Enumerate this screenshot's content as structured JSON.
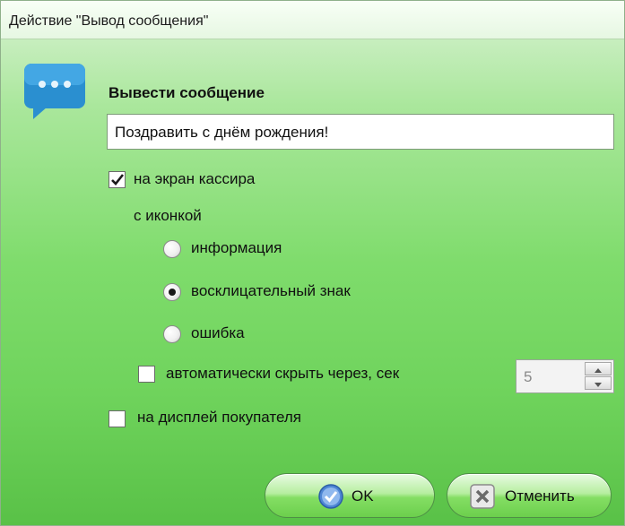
{
  "window": {
    "title": "Действие \"Вывод сообщения\""
  },
  "icons": {
    "message": "speech-bubble-icon",
    "ok": "check-circle-icon",
    "cancel": "x-box-icon"
  },
  "form": {
    "heading": "Вывести сообщение",
    "message_value": "Поздравить с днём рождения!",
    "cashier_screen": {
      "label": "на экран кассира",
      "checked": true
    },
    "icon_group_label": "с иконкой",
    "icon_options": [
      {
        "label": "информация",
        "selected": false
      },
      {
        "label": "восклицательный знак",
        "selected": true
      },
      {
        "label": "ошибка",
        "selected": false
      }
    ],
    "auto_hide": {
      "label": "автоматически скрыть через, сек",
      "checked": false,
      "seconds": "5"
    },
    "customer_display": {
      "label": "на дисплей покупателя",
      "checked": false
    }
  },
  "buttons": {
    "ok": "OK",
    "cancel": "Отменить"
  }
}
